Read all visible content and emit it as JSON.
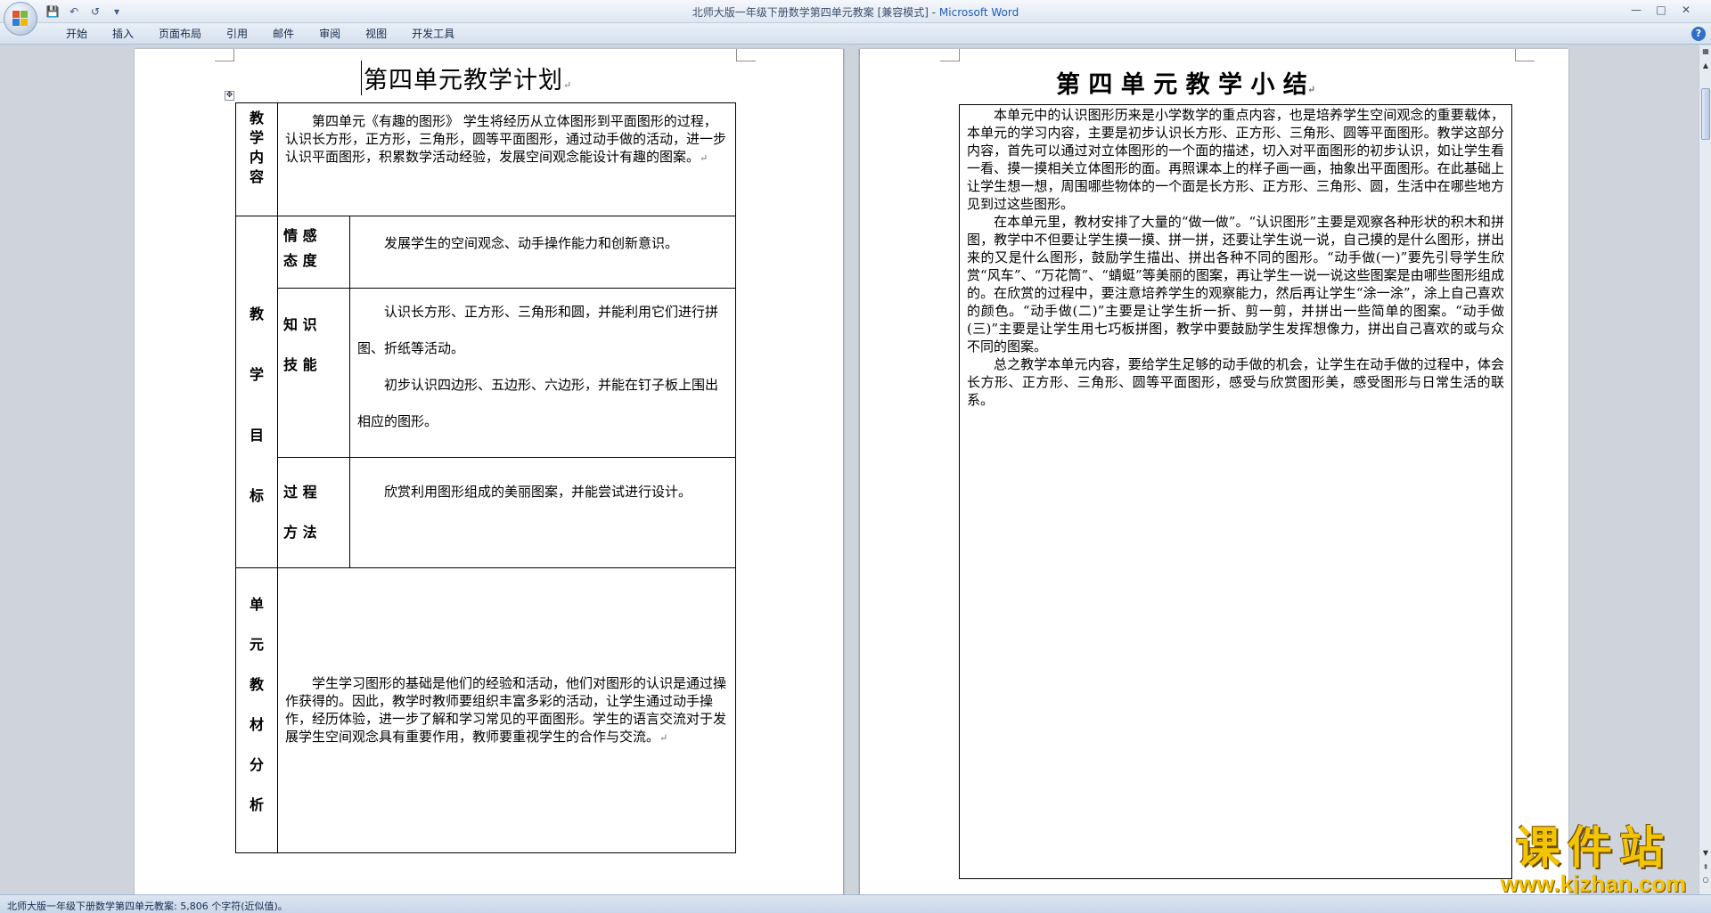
{
  "window": {
    "title": "北师大版一年级下册数学第四单元教案 [兼容模式] - ",
    "app_name": "Microsoft Word"
  },
  "quick_access": {
    "save_icon": "save-icon",
    "undo_icon": "undo-icon",
    "redo_icon": "redo-icon",
    "customize_icon": "customize-qat-icon"
  },
  "ribbon": {
    "tabs": [
      "开始",
      "插入",
      "页面布局",
      "引用",
      "邮件",
      "审阅",
      "视图",
      "开发工具"
    ]
  },
  "page1": {
    "title": "第四单元教学计划",
    "row_content": {
      "label": [
        "教",
        "学",
        "内",
        "容"
      ],
      "text": "第四单元《有趣的图形》 学生将经历从立体图形到平面图形的过程，认识长方形，正方形，三角形，圆等平面图形，通过动手做的活动，进一步认识平面图形，积累数学活动经验，发展空间观念能设计有趣的图案。"
    },
    "row_goals": {
      "label": [
        "教",
        "学",
        "目",
        "标"
      ],
      "items": [
        {
          "label_line1": "情 感",
          "label_line2": "态 度",
          "text": [
            "发展学生的空间观念、动手操作能力和创新意识。"
          ]
        },
        {
          "label_line1": "知 识",
          "label_line2": "技 能",
          "text": [
            "认识长方形、正方形、三角形和圆，并能利用它们进行拼图、折纸等活动。",
            "初步认识四边形、五边形、六边形，并能在钉子板上围出相应的图形。"
          ]
        },
        {
          "label_line1": "过 程",
          "label_line2": "方 法",
          "text": [
            "欣赏利用图形组成的美丽图案，并能尝试进行设计。"
          ]
        }
      ]
    },
    "row_analysis": {
      "label": [
        "单",
        "元",
        "教",
        "材",
        "分",
        "析"
      ],
      "text": "学生学习图形的基础是他们的经验和活动，他们对图形的认识是通过操作获得的。因此，教学时教师要组织丰富多彩的活动，让学生通过动手操作，经历体验，进一步了解和学习常见的平面图形。学生的语言交流对于发展学生空间观念具有重要作用，教师要重视学生的合作与交流。"
    }
  },
  "page2": {
    "title": "第 四 单 元 教 学 小 结",
    "paragraphs": [
      "本单元中的认识图形历来是小学数学的重点内容，也是培养学生空间观念的重要载体，本单元的学习内容，主要是初步认识长方形、正方形、三角形、圆等平面图形。教学这部分内容，首先可以通过对立体图形的一个面的描述，切入对平面图形的初步认识，如让学生看一看、摸一摸相关立体图形的面。再照课本上的样子画一画，抽象出平面图形。在此基础上让学生想一想，周围哪些物体的一个面是长方形、正方形、三角形、圆，生活中在哪些地方见到过这些图形。",
      "在本单元里，教材安排了大量的“做一做”。“认识图形”主要是观察各种形状的积木和拼图，教学中不但要让学生摸一摸、拼一拼，还要让学生说一说，自己摸的是什么图形，拼出来的又是什么图形，鼓励学生描出、拼出各种不同的图形。“动手做(一)”要先引导学生欣赏“风车”、“万花筒”、“蜻蜓”等美丽的图案，再让学生一说一说这些图案是由哪些图形组成的。在欣赏的过程中，要注意培养学生的观察能力，然后再让学生“涂一涂”，涂上自己喜欢的颜色。“动手做(二)”主要是让学生折一折、剪一剪，并拼出一些简单的图案。“动手做(三)”主要是让学生用七巧板拼图，教学中要鼓励学生发挥想像力，拼出自己喜欢的或与众不同的图案。",
      "总之教学本单元内容，要给学生足够的动手做的机会，让学生在动手做的过程中，体会长方形、正方形、三角形、圆等平面图形，感受与欣赏图形美，感受图形与日常生活的联系。"
    ]
  },
  "watermark": {
    "cn": "课件站",
    "url": "www.kjzhan.com"
  },
  "status": {
    "text": "北师大版一年级下册数学第四单元教案: 5,806 个字符(近似值)。"
  },
  "colors": {
    "accent": "#1f5eb5",
    "watermark": "#f3c400"
  }
}
